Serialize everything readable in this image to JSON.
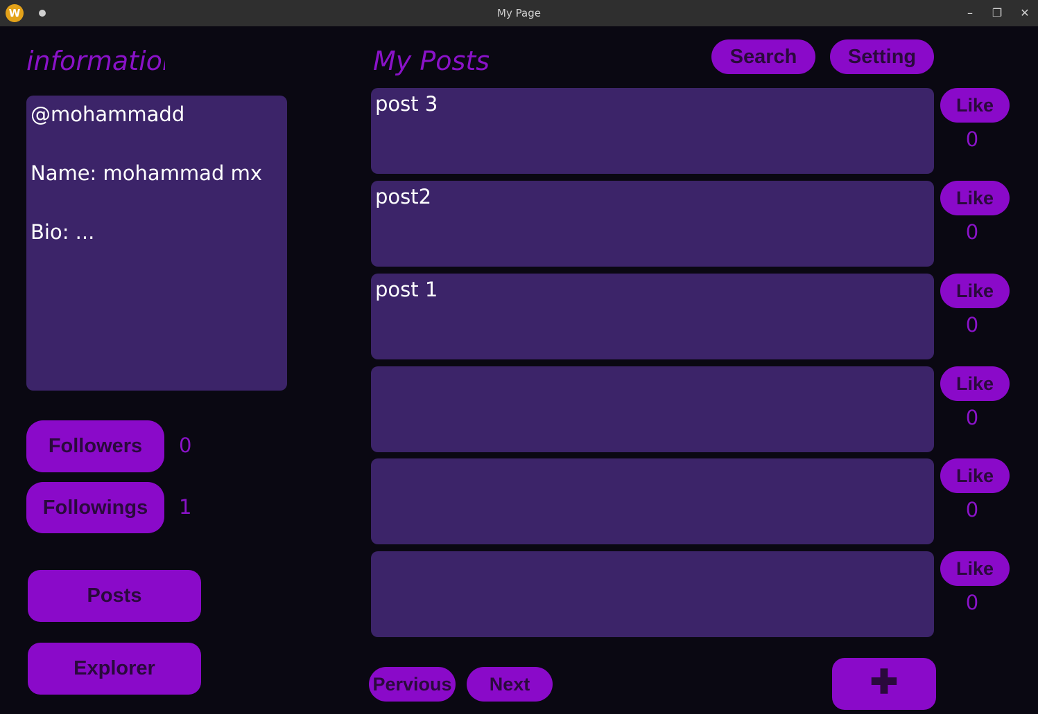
{
  "window": {
    "title": "My Page",
    "app_icon_letter": "W",
    "controls": [
      "minimize",
      "maximize",
      "close"
    ]
  },
  "sidebar": {
    "heading": "information",
    "profile": {
      "username": "@mohammadd",
      "name_line": "Name: mohammad mx",
      "bio_line": "Bio: ..."
    },
    "followers_label": "Followers",
    "followers_count": "0",
    "followings_label": "Followings",
    "followings_count": "1",
    "posts_label": "Posts",
    "explorer_label": "Explorer"
  },
  "main": {
    "heading": "My Posts",
    "search_label": "Search",
    "setting_label": "Setting",
    "posts": [
      {
        "text": "post 3",
        "like_label": "Like",
        "likes": "0"
      },
      {
        "text": "post2",
        "like_label": "Like",
        "likes": "0"
      },
      {
        "text": "post 1",
        "like_label": "Like",
        "likes": "0"
      },
      {
        "text": "",
        "like_label": "Like",
        "likes": "0"
      },
      {
        "text": "",
        "like_label": "Like",
        "likes": "0"
      },
      {
        "text": "",
        "like_label": "Like",
        "likes": "0"
      }
    ],
    "previous_label": "Pervious",
    "next_label": "Next",
    "add_icon": "plus-icon"
  },
  "colors": {
    "background": "#0a0812",
    "card": "#3c2469",
    "accent": "#8a0ac9",
    "accent_text": "#8a12c8",
    "button_text": "#2a0a3c"
  }
}
